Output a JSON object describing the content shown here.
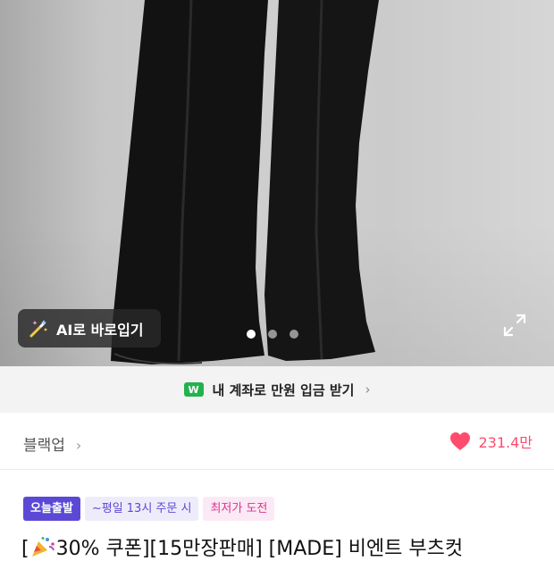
{
  "product_image": {
    "ai_button_label": "AI로 바로입기",
    "carousel_dots": 3,
    "carousel_active_index": 0
  },
  "account_banner": {
    "badge_text": "W",
    "label": "내 계좌로 만원 입금 받기",
    "chevron": "›"
  },
  "brand_row": {
    "brand_name": "블랙업",
    "brand_chevron": "›",
    "like_count": "231.4만",
    "heart_color": "#ff4b6e"
  },
  "badges": [
    {
      "label": "오늘출발"
    },
    {
      "label": "~평일 13시 주문 시"
    },
    {
      "label": "최저가 도전"
    }
  ],
  "title": {
    "prefix": "[",
    "text": "30% 쿠폰][15만장판매] [MADE] 비엔트 부츠컷"
  },
  "colors": {
    "accent_purple": "#5b49d6",
    "accent_pink": "#d9358f",
    "wallet_green": "#22b24c"
  }
}
